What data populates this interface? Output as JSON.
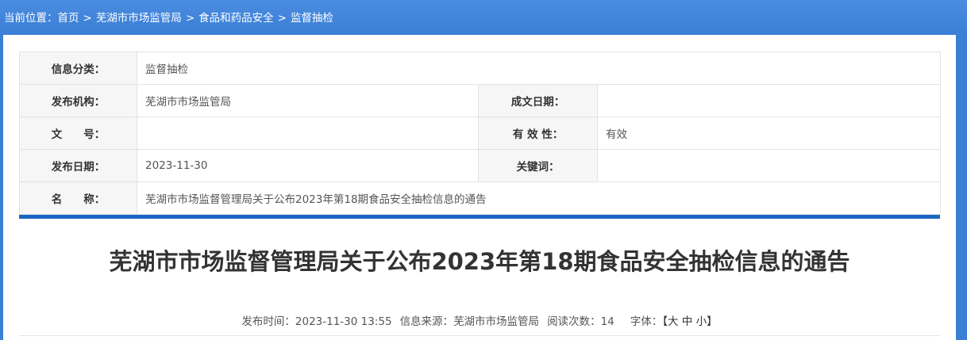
{
  "breadcrumb": {
    "prefix": "当前位置：",
    "items": [
      "首页",
      "芜湖市市场监管局",
      "食品和药品安全",
      "监督抽检"
    ],
    "separator": ">"
  },
  "meta": {
    "category_label": "信息分类：",
    "category_value": "监督抽检",
    "publisher_label": "发布机构：",
    "publisher_value": "芜湖市市场监管局",
    "written_date_label": "成文日期：",
    "written_date_value": "",
    "doc_no_label": "文　　号：",
    "doc_no_value": "",
    "validity_label": "有 效 性：",
    "validity_value": "有效",
    "publish_date_label": "发布日期：",
    "publish_date_value": "2023-11-30",
    "keywords_label": "关键词：",
    "keywords_value": "",
    "name_label": "名　　称：",
    "name_value": "芜湖市市场监督管理局关于公布2023年第18期食品安全抽检信息的通告"
  },
  "article": {
    "title": "芜湖市市场监督管理局关于公布2023年第18期食品安全抽检信息的通告",
    "publish_time_label": "发布时间：",
    "publish_time": "2023-11-30 13:55",
    "source_label": "信息来源：",
    "source": "芜湖市市场监管局",
    "views_label": "阅读次数：",
    "views": "14",
    "font_label": "字体：",
    "font_open": "【",
    "font_large": "大",
    "font_medium": "中",
    "font_small": "小",
    "font_close": "】"
  },
  "colors": {
    "background": "#3a7fd5",
    "accent_bar": "#1a66c4"
  }
}
